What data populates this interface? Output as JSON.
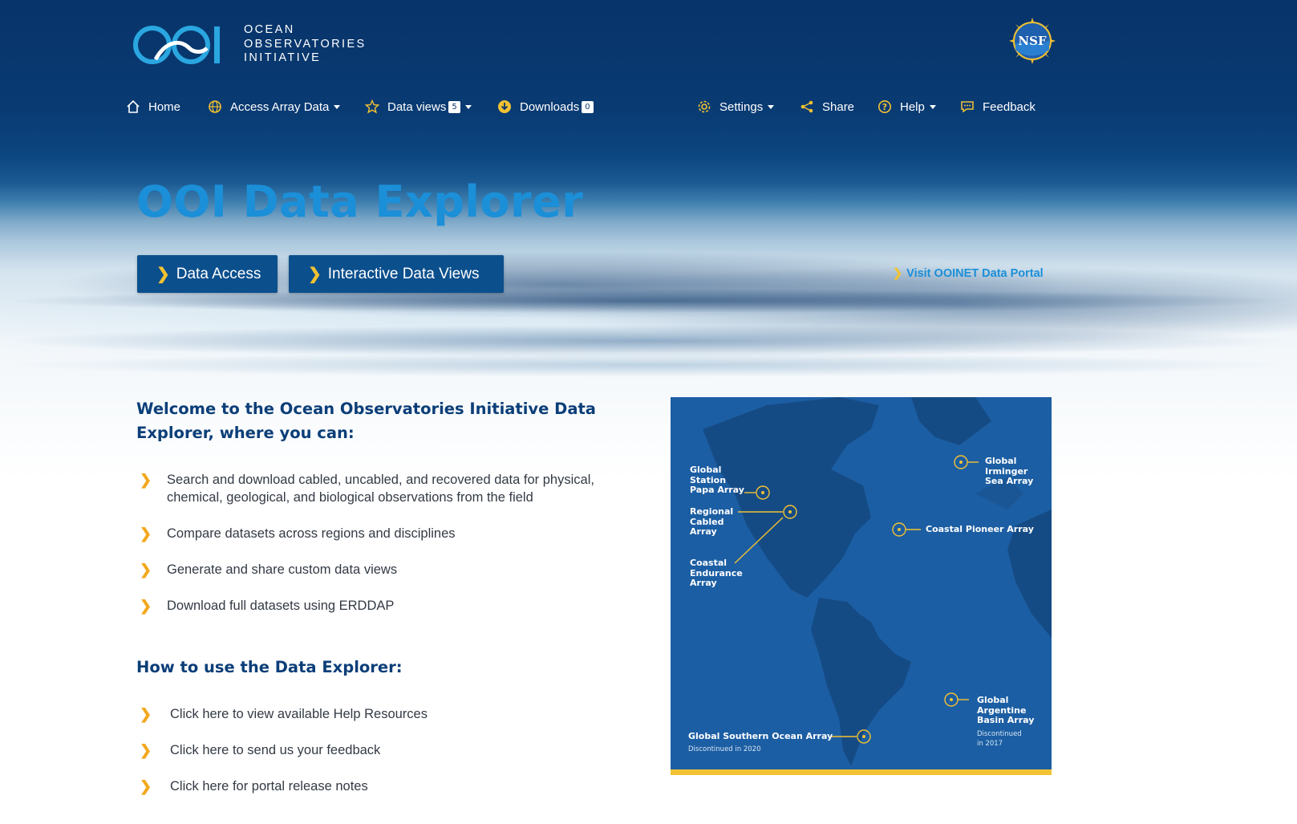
{
  "logo": {
    "line1": "OCEAN",
    "line2": "OBSERVATORIES",
    "line3": "INITIATIVE"
  },
  "nsf_label": "NSF",
  "nav": {
    "home": "Home",
    "access": "Access Array Data",
    "dataviews": "Data views",
    "dataviews_count": "5",
    "downloads": "Downloads",
    "downloads_count": "0",
    "settings": "Settings",
    "share": "Share",
    "help": "Help",
    "feedback": "Feedback"
  },
  "hero": {
    "title": "OOI Data Explorer",
    "btn_access": "Data Access",
    "btn_views": "Interactive Data Views",
    "portal_link": "Visit OOINET Data Portal"
  },
  "welcome": {
    "heading_line1": "Welcome to the Ocean Observatories Initiative Data",
    "heading_line2": "Explorer, where you can:",
    "items": [
      "Search and download cabled, uncabled, and recovered data for physical, chemical, geological, and biological observations from the field",
      "Compare datasets across regions and disciplines",
      "Generate and share custom data views",
      "Download full datasets using ERDDAP"
    ]
  },
  "howto": {
    "heading": "How to use the Data Explorer:",
    "links": [
      "Click here to view available Help Resources",
      "Click here to send us your feedback",
      "Click here for portal release notes"
    ]
  },
  "map": {
    "papa": [
      "Global",
      "Station",
      "Papa Array"
    ],
    "cabled": [
      "Regional",
      "Cabled",
      "Array"
    ],
    "endurance": [
      "Coastal",
      "Endurance",
      "Array"
    ],
    "irminger": [
      "Global",
      "Irminger",
      "Sea Array"
    ],
    "pioneer": "Coastal Pioneer Array",
    "argentine": [
      "Global",
      "Argentine",
      "Basin Array"
    ],
    "argentine_note": [
      "Discontinued",
      "in 2017"
    ],
    "southern": "Global Southern Ocean Array",
    "southern_note": "Discontinued in 2020"
  },
  "colors": {
    "navy": "#07346a",
    "title_blue": "#1b8fd8",
    "accent_yellow": "#f2c232",
    "heading_navy": "#0b3e78",
    "button_blue": "#0b4f8d"
  }
}
